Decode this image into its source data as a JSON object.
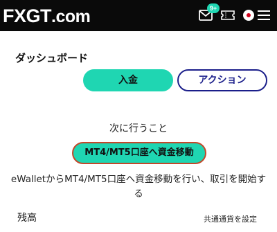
{
  "header": {
    "logo_fx": "FX",
    "logo_g": "G",
    "logo_t": "T",
    "logo_dotcom": ".com",
    "badge": "9+",
    "icons": [
      "mail-icon",
      "ticket-icon",
      "flag-icon",
      "menu-icon"
    ]
  },
  "dashboard": {
    "title": "ダッシュボード",
    "deposit_label": "入金",
    "action_label": "アクション"
  },
  "next_step": {
    "label": "次に行うこと",
    "button_label": "MT4/MT5口座へ資金移動",
    "description": "eWalletからMT4/MT5口座へ資金移動を行い、取引を開始する"
  },
  "balance": {
    "label": "残高",
    "currency_link": "共通通貨を設定"
  },
  "colors": {
    "accent": "#1fd6b2",
    "navy": "#1a1e8a",
    "highlight_border": "#c2482b",
    "topbar": "#0a0a0a"
  }
}
